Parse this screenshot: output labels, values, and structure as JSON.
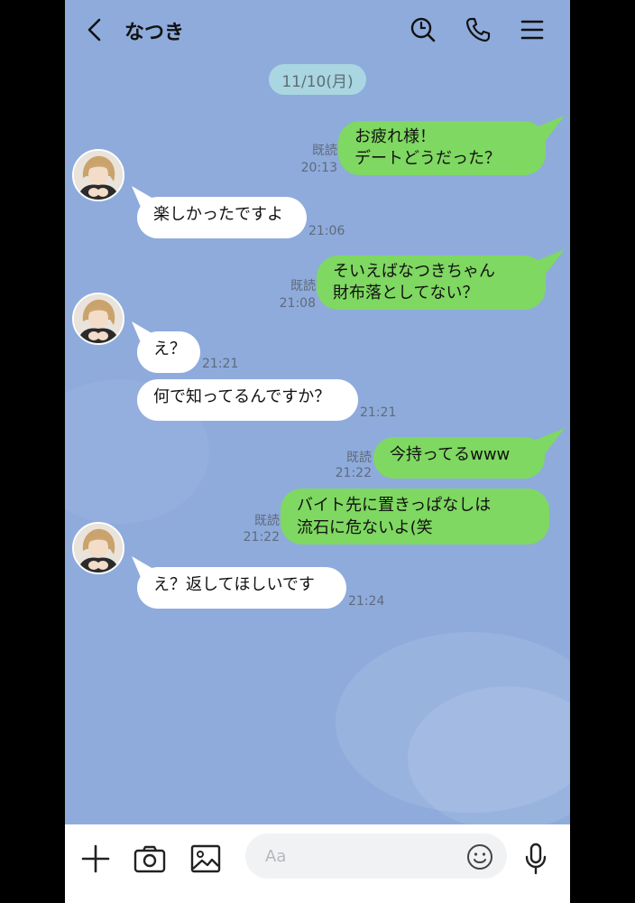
{
  "header": {
    "back_icon": "chevron-left-icon",
    "contact_name": "なつき",
    "search_icon": "search-icon",
    "call_icon": "phone-icon",
    "menu_icon": "menu-icon"
  },
  "chat": {
    "date": "11/10(月)",
    "messages": [
      {
        "from": "me",
        "lines": [
          "お疲れ様！",
          "デートどうだった？"
        ],
        "read": "既読",
        "time": "20:13"
      },
      {
        "from": "them",
        "lines": [
          "楽しかったですよ"
        ],
        "time": "21:06"
      },
      {
        "from": "me",
        "lines": [
          "そいえばなつきちゃん",
          "財布落としてない？"
        ],
        "read": "既読",
        "time": "21:08"
      },
      {
        "from": "them",
        "lines": [
          "え？"
        ],
        "time": "21:21"
      },
      {
        "from": "them",
        "lines": [
          "何で知ってるんですか？"
        ],
        "time": "21:21"
      },
      {
        "from": "me",
        "lines": [
          "今持ってるwww"
        ],
        "read": "既読",
        "time": "21:22"
      },
      {
        "from": "me",
        "lines": [
          "バイト先に置きっぱなしは",
          "流石に危ないよ(笑"
        ],
        "read": "既読",
        "time": "21:22"
      },
      {
        "from": "them",
        "lines": [
          "え？返してほしいです"
        ],
        "time": "21:24"
      }
    ]
  },
  "input_bar": {
    "add_icon": "plus-icon",
    "camera_icon": "camera-icon",
    "image_icon": "image-icon",
    "placeholder": "Aa",
    "emoji_icon": "smiley-icon",
    "mic_icon": "microphone-icon"
  },
  "colors": {
    "background": "#8eabdc",
    "my_bubble": "#7fd861",
    "their_bubble": "#ffffff",
    "date_pill": "#a9d6e0"
  }
}
